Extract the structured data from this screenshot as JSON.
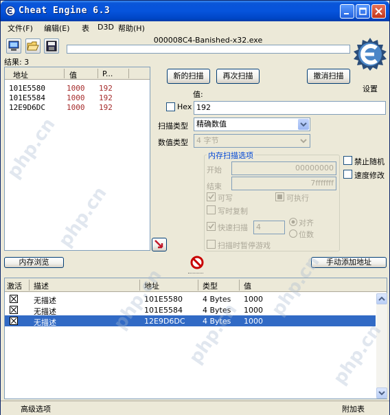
{
  "window": {
    "title": "Cheat Engine 6.3",
    "title_icon": "cheat-engine-icon",
    "controls": [
      "minimize-icon",
      "maximize-icon",
      "close-icon"
    ]
  },
  "menu": [
    "文件(F)",
    "编辑(E)",
    "表",
    "D3D",
    "帮助(H)"
  ],
  "toolbar": {
    "icons": [
      "open-process-icon",
      "open-file-icon",
      "save-icon"
    ],
    "process_name": "000008C4-Banished-x32.exe",
    "settings_label": "设置",
    "logo_icon": "cheat-engine-logo-icon"
  },
  "results": {
    "label": "结果: 3",
    "columns": [
      "地址",
      "值",
      "P..."
    ],
    "rows": [
      {
        "address": "101E5580",
        "value": "1000",
        "previous": "192"
      },
      {
        "address": "101E5584",
        "value": "1000",
        "previous": "192"
      },
      {
        "address": "12E9D6DC",
        "value": "1000",
        "previous": "192"
      }
    ],
    "colors": {
      "address": "#000000",
      "value": "#a52a2a",
      "previous": "#a52a2a"
    }
  },
  "scan": {
    "new_scan": "新的扫描",
    "next_scan": "再次扫描",
    "undo_scan": "撤消扫描",
    "value_label": "值:",
    "hex_label": "Hex",
    "value_input": "192",
    "scan_type_label": "扫描类型",
    "scan_type_value": "精确数值",
    "value_type_label": "数值类型",
    "value_type_value": "4 字节"
  },
  "memory_options": {
    "title": "内存扫描选项",
    "start_label": "开始",
    "start_value": "00000000",
    "stop_label": "结束",
    "stop_value": "7fffffff",
    "writable": "可写",
    "executable": "可执行",
    "copy_on_write": "写时复制",
    "fast_scan": "快速扫描",
    "fast_scan_value": "4",
    "alignment": "对齐",
    "last_digits": "位数",
    "pause_game": "扫描时暂停游戏"
  },
  "side_options": {
    "disable_random": "禁止随机",
    "speedhack": "速度修改"
  },
  "middle_bar": {
    "memory_view": "内存浏览",
    "add_manually": "手动添加地址",
    "arrow_icon": "arrow-add-icon",
    "stop_icon": "no-entry-icon"
  },
  "address_list": {
    "columns": [
      "激活",
      "描述",
      "地址",
      "类型",
      "值"
    ],
    "rows": [
      {
        "description": "无描述",
        "address": "101E5580",
        "type": "4 Bytes",
        "value": "1000"
      },
      {
        "description": "无描述",
        "address": "101E5584",
        "type": "4 Bytes",
        "value": "1000"
      },
      {
        "description": "无描述",
        "address": "12E9D6DC",
        "type": "4 Bytes",
        "value": "1000"
      }
    ],
    "selected_row": 2,
    "selection_color": "#316ac5"
  },
  "status": {
    "advanced_options": "高级选项",
    "table_extras": "附加表"
  },
  "watermark": "php.cn"
}
